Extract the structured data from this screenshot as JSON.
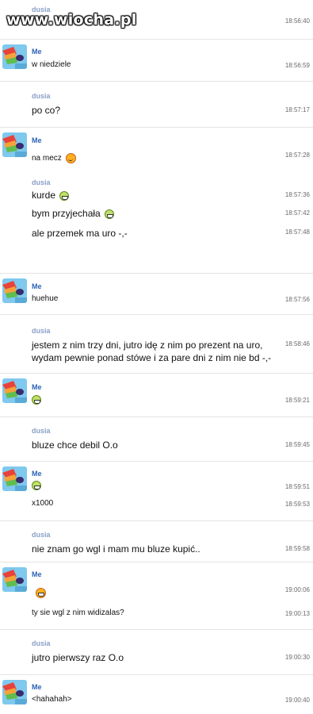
{
  "watermark": "www.wiocha.pl",
  "messages": [
    {
      "sender": "dusia",
      "lines": [
        {
          "text": "",
          "time": "18:56:40"
        }
      ]
    },
    {
      "sender": "Me",
      "lines": [
        {
          "text": "w niedziele",
          "time": "18:56:59"
        }
      ]
    },
    {
      "sender": "dusia",
      "lines": [
        {
          "text": "po co?",
          "time": "18:57:17"
        }
      ]
    },
    {
      "sender": "Me",
      "lines": [
        {
          "text": "na mecz",
          "time": "18:57:28",
          "emoticon": "wink-emoticon"
        }
      ]
    },
    {
      "sender": "dusia",
      "lines": [
        {
          "text": "kurde",
          "time": "18:57:36",
          "emoticon": "grin-emoticon"
        },
        {
          "text": "bym przyjechała",
          "time": "18:57:42",
          "emoticon": "grin-emoticon"
        },
        {
          "text": "ale przemek ma uro -,-",
          "time": "18:57:48"
        }
      ]
    },
    {
      "sender": "Me",
      "lines": [
        {
          "text": "huehue",
          "time": "18:57:56"
        }
      ]
    },
    {
      "sender": "dusia",
      "lines": [
        {
          "text": "jestem z nim trzy dni, jutro idę z nim po prezent na uro,",
          "time": "18:58:46"
        },
        {
          "text": "wydam pewnie ponad stówe i za pare dni z nim nie bd -,-",
          "time": ""
        }
      ]
    },
    {
      "sender": "Me",
      "lines": [
        {
          "text": "",
          "time": "18:59:21",
          "emoticon": "grin-emoticon"
        }
      ]
    },
    {
      "sender": "dusia",
      "lines": [
        {
          "text": "bluze chce debil O.o",
          "time": "18:59:45"
        }
      ]
    },
    {
      "sender": "Me",
      "lines": [
        {
          "text": "",
          "time": "18:59:51",
          "emoticon": "grin-emoticon"
        },
        {
          "text": "x1000",
          "time": "18:59:53"
        }
      ]
    },
    {
      "sender": "dusia",
      "lines": [
        {
          "text": "nie znam go wgl i mam mu bluze kupić..",
          "time": "18:59:58"
        }
      ]
    },
    {
      "sender": "Me",
      "lines": [
        {
          "text": "",
          "time": "19:00:06",
          "emoticon": "smile-emoticon"
        },
        {
          "text": "ty sie wgl z nim widizalas?",
          "time": "19:00:13"
        }
      ]
    },
    {
      "sender": "dusia",
      "lines": [
        {
          "text": "jutro pierwszy raz O.o",
          "time": "19:00:30"
        }
      ]
    },
    {
      "sender": "Me",
      "lines": [
        {
          "text": "<hahahah>",
          "time": "19:00:40"
        }
      ]
    }
  ]
}
